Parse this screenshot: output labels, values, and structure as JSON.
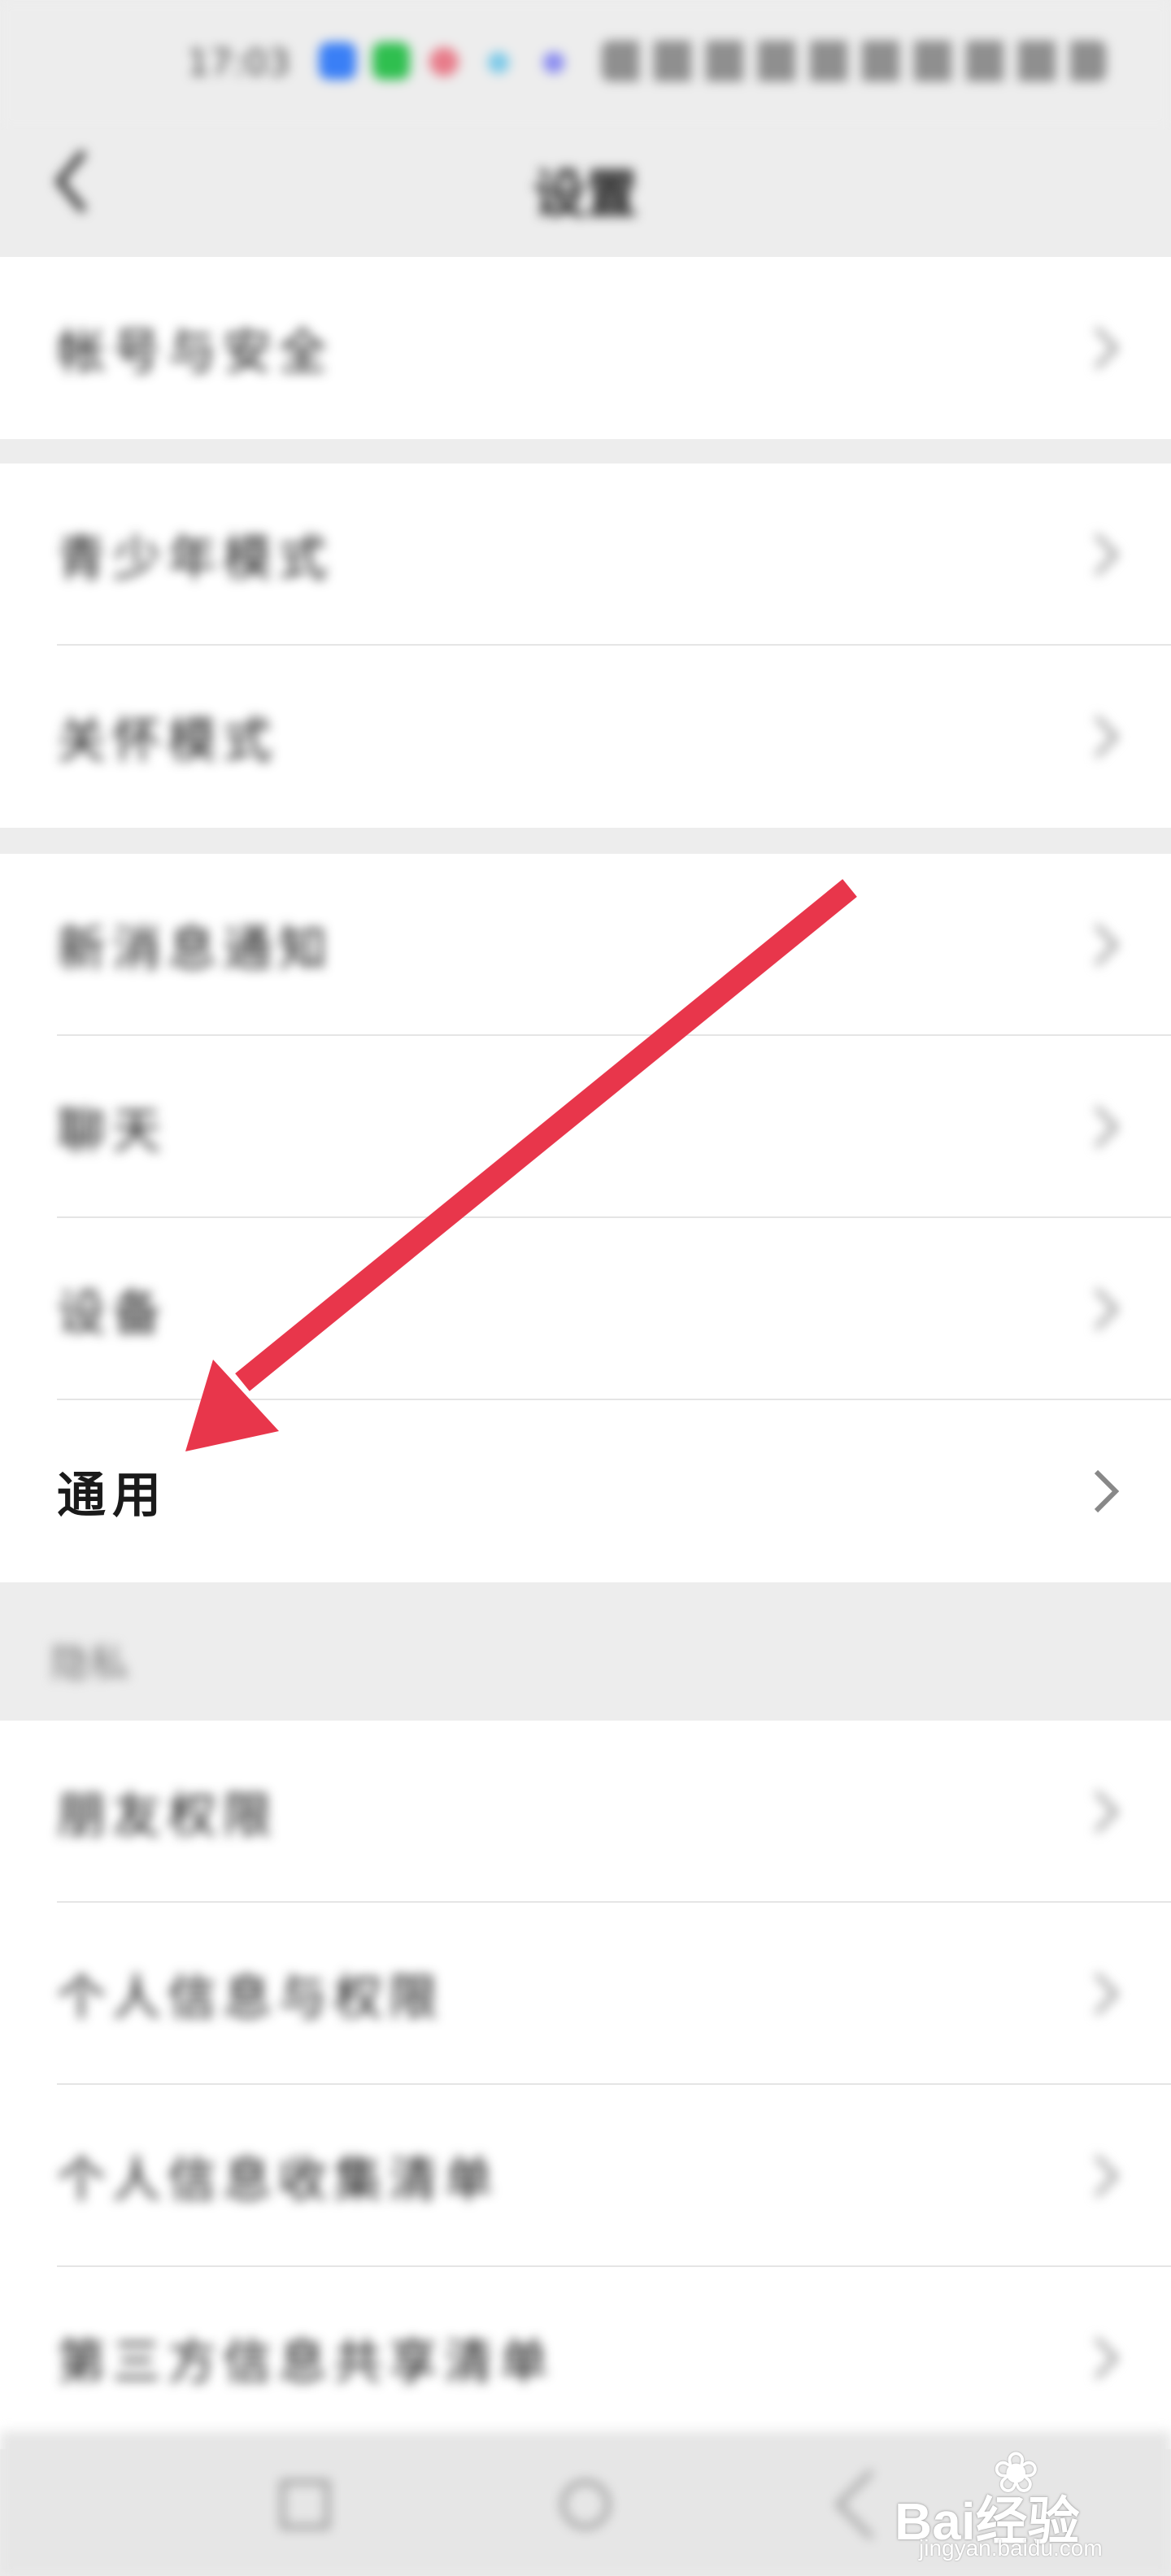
{
  "status_bar": {
    "time": "17:03"
  },
  "header": {
    "title": "设置"
  },
  "groups": [
    {
      "items": [
        {
          "label": "帐号与安全"
        }
      ]
    },
    {
      "items": [
        {
          "label": "青少年模式"
        },
        {
          "label": "关怀模式"
        }
      ]
    },
    {
      "items": [
        {
          "label": "新消息通知"
        },
        {
          "label": "聊天"
        },
        {
          "label": "设备"
        },
        {
          "label": "通用"
        }
      ]
    },
    {
      "header": "隐私",
      "items": [
        {
          "label": "朋友权限"
        },
        {
          "label": "个人信息与权限"
        },
        {
          "label": "个人信息收集清单"
        },
        {
          "label": "第三方信息共享清单"
        }
      ]
    }
  ],
  "annotation": {
    "color": "#e8364b",
    "points_to": "通用"
  },
  "watermark": {
    "brand": "Bai经验",
    "url": "jingyan.baidu.com"
  }
}
